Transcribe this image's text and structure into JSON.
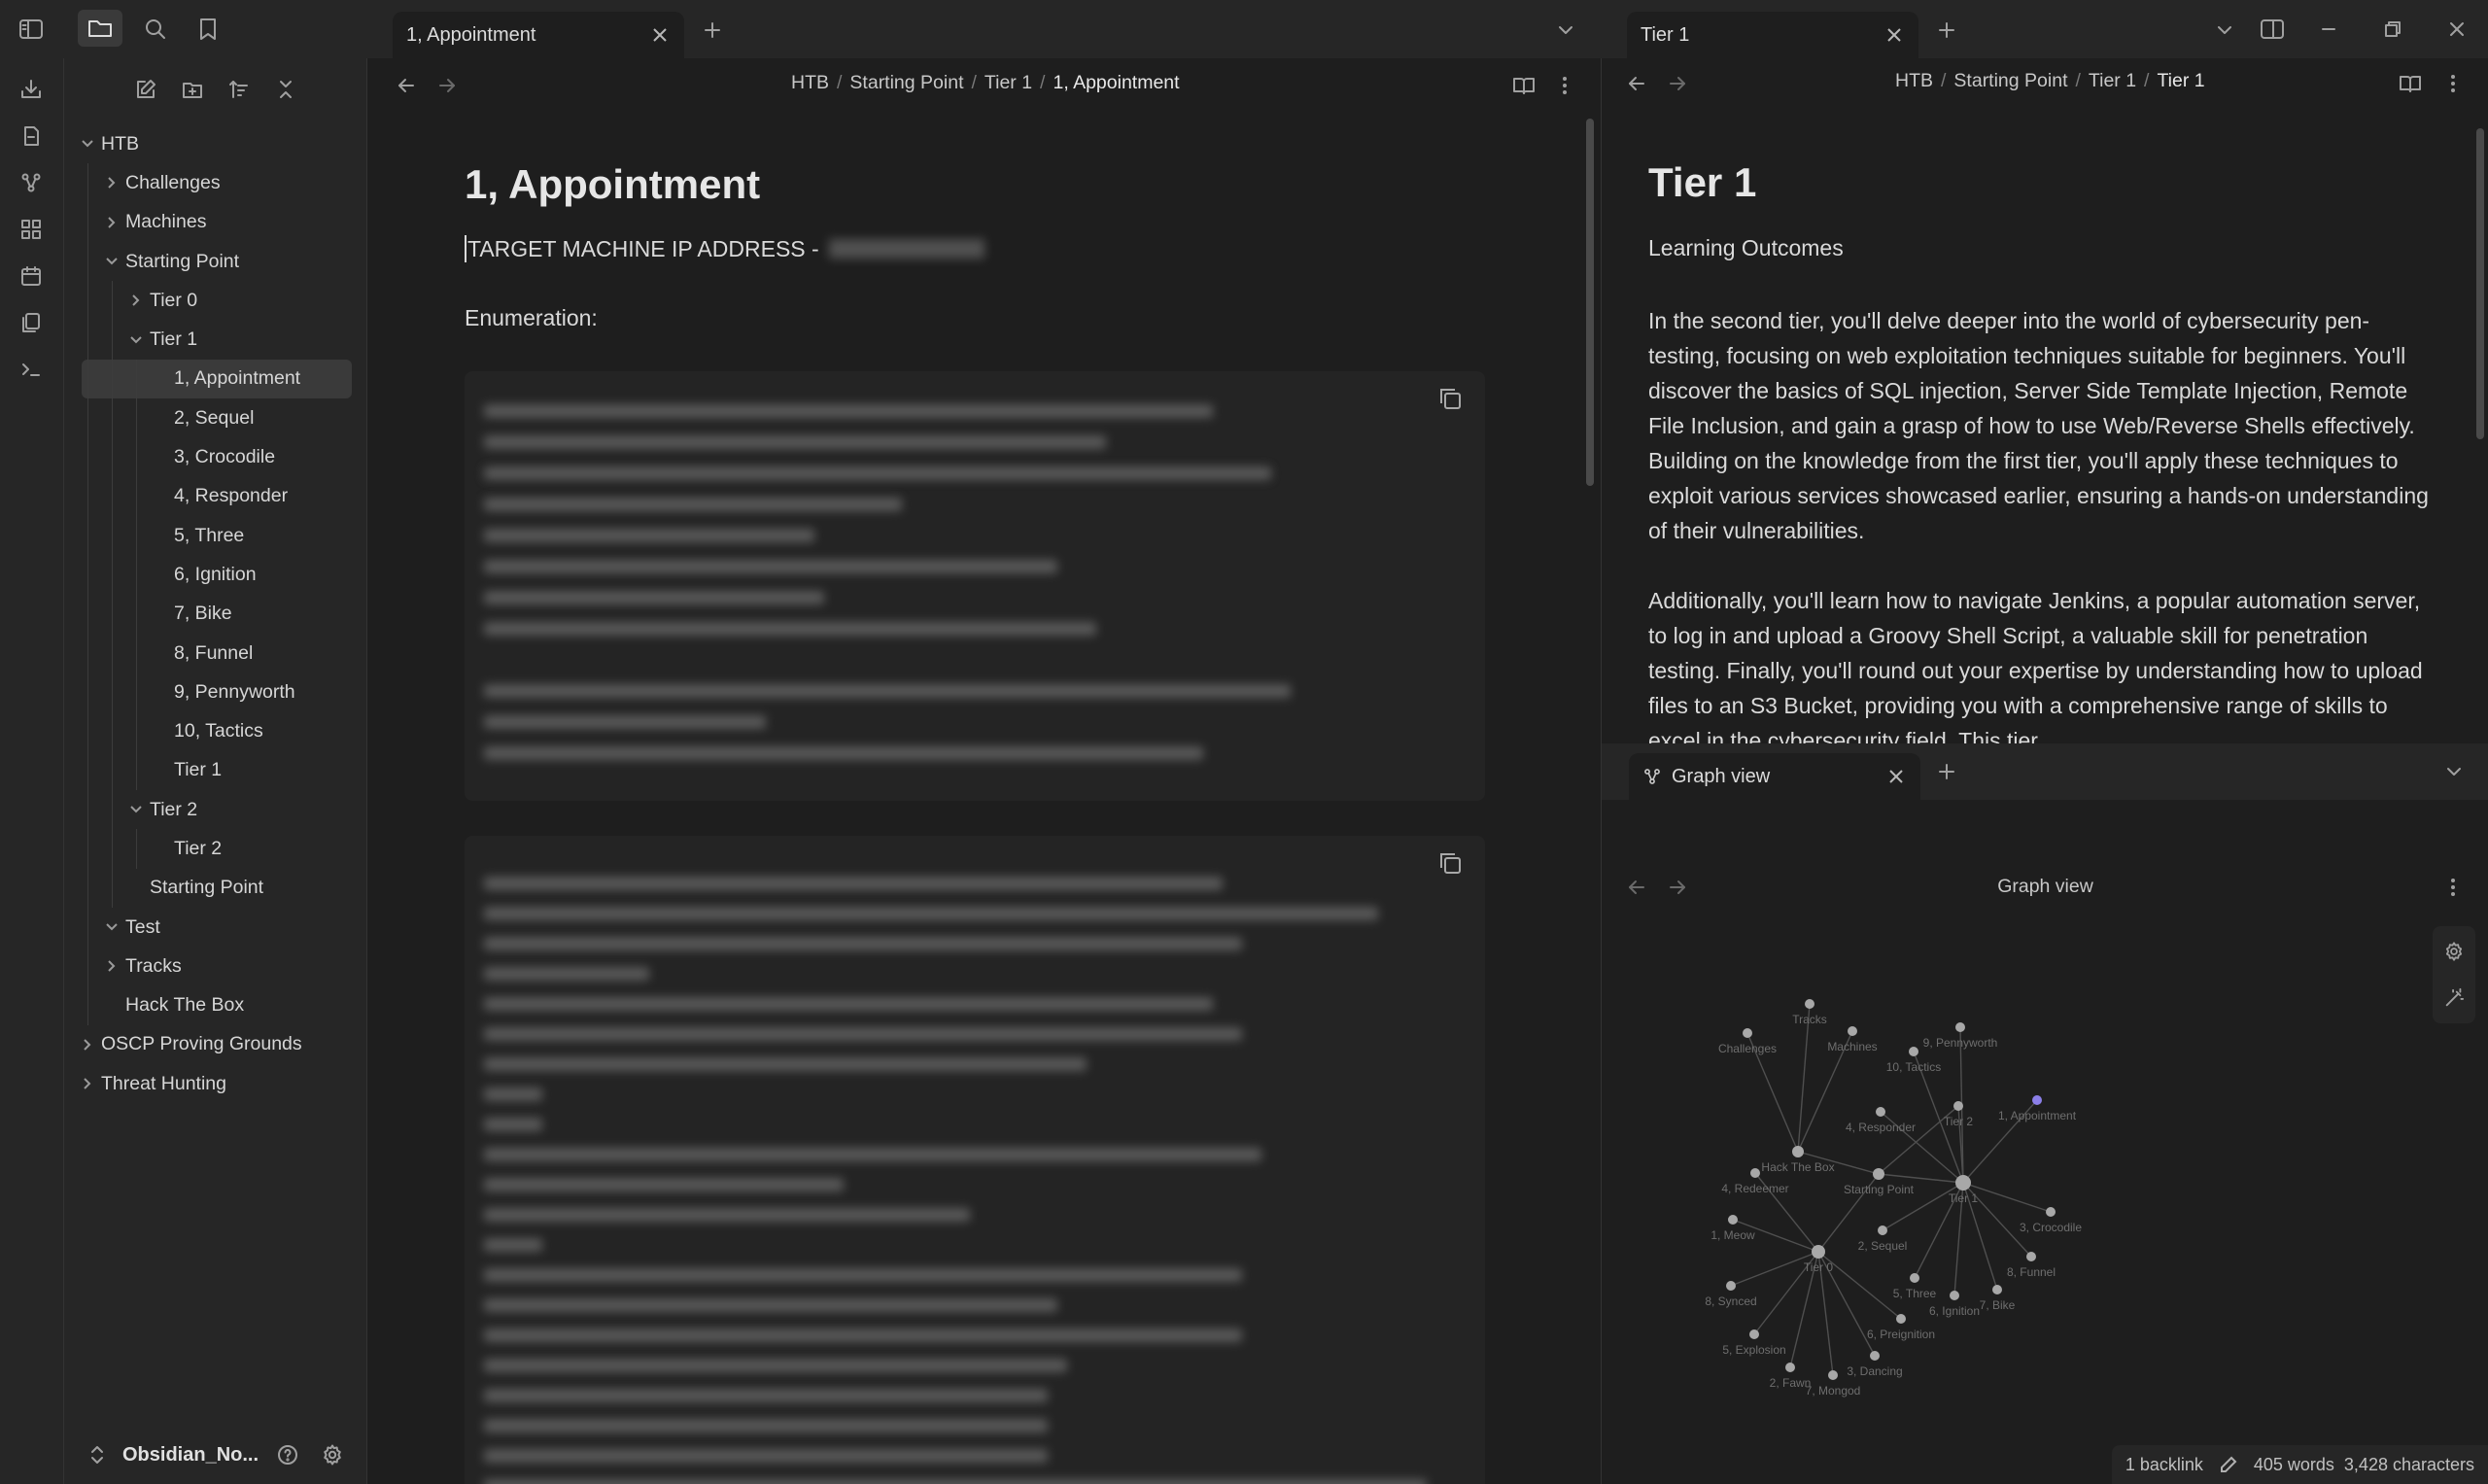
{
  "left_tab": {
    "label": "1, Appointment"
  },
  "right_tab": {
    "label": "Tier 1"
  },
  "graph_tab": {
    "label": "Graph view"
  },
  "vault": {
    "name": "Obsidian_No..."
  },
  "tree": [
    {
      "label": "HTB",
      "depth": 0,
      "chevron": "down"
    },
    {
      "label": "Challenges",
      "depth": 1,
      "chevron": "right"
    },
    {
      "label": "Machines",
      "depth": 1,
      "chevron": "right"
    },
    {
      "label": "Starting Point",
      "depth": 1,
      "chevron": "down"
    },
    {
      "label": "Tier 0",
      "depth": 2,
      "chevron": "right"
    },
    {
      "label": "Tier 1",
      "depth": 2,
      "chevron": "down"
    },
    {
      "label": "1, Appointment",
      "depth": 3,
      "chevron": "none",
      "active": true
    },
    {
      "label": "2, Sequel",
      "depth": 3,
      "chevron": "none"
    },
    {
      "label": "3, Crocodile",
      "depth": 3,
      "chevron": "none"
    },
    {
      "label": "4, Responder",
      "depth": 3,
      "chevron": "none"
    },
    {
      "label": "5, Three",
      "depth": 3,
      "chevron": "none"
    },
    {
      "label": "6, Ignition",
      "depth": 3,
      "chevron": "none"
    },
    {
      "label": "7, Bike",
      "depth": 3,
      "chevron": "none"
    },
    {
      "label": "8, Funnel",
      "depth": 3,
      "chevron": "none"
    },
    {
      "label": "9, Pennyworth",
      "depth": 3,
      "chevron": "none"
    },
    {
      "label": "10, Tactics",
      "depth": 3,
      "chevron": "none"
    },
    {
      "label": "Tier 1",
      "depth": 3,
      "chevron": "none"
    },
    {
      "label": "Tier 2",
      "depth": 2,
      "chevron": "down"
    },
    {
      "label": "Tier 2",
      "depth": 3,
      "chevron": "none"
    },
    {
      "label": "Starting Point",
      "depth": 2,
      "chevron": "none"
    },
    {
      "label": "Test",
      "depth": 1,
      "chevron": "down"
    },
    {
      "label": "Tracks",
      "depth": 1,
      "chevron": "right"
    },
    {
      "label": "Hack The Box",
      "depth": 1,
      "chevron": "none"
    },
    {
      "label": "OSCP Proving Grounds",
      "depth": 0,
      "chevron": "right"
    },
    {
      "label": "Threat Hunting",
      "depth": 0,
      "chevron": "right"
    }
  ],
  "left_note": {
    "breadcrumb": [
      "HTB",
      "Starting Point",
      "Tier 1",
      "1, Appointment"
    ],
    "title": "1, Appointment",
    "ip_line": "TARGET MACHINE IP ADDRESS -",
    "enumeration": "Enumeration:"
  },
  "right_note": {
    "breadcrumb": [
      "HTB",
      "Starting Point",
      "Tier 1",
      "Tier 1"
    ],
    "title": "Tier 1",
    "subtitle": "Learning Outcomes",
    "para1": "In the second tier, you'll delve deeper into the world of cybersecurity pen-testing, focusing on web exploitation techniques suitable for beginners. You'll discover the basics of SQL injection, Server Side Template Injection, Remote File Inclusion, and gain a grasp of how to use Web/Reverse Shells effectively. Building on the knowledge from the first tier, you'll apply these techniques to exploit various services showcased earlier, ensuring a hands-on understanding of their vulnerabilities.",
    "para2": "Additionally, you'll learn how to navigate Jenkins, a popular automation server, to log in and upload a Groovy Shell Script, a valuable skill for penetration testing. Finally, you'll round out your expertise by understanding how to upload files to an S3 Bucket, providing you with a comprehensive range of skills to excel in the cybersecurity field. This tier"
  },
  "graph": {
    "header": "Graph view",
    "node_color": "#a8a8a8",
    "accent_node_color": "#8b7fe8",
    "nodes": [
      {
        "id": "challenges",
        "label": "Challenges"
      },
      {
        "id": "tracks",
        "label": "Tracks"
      },
      {
        "id": "machines",
        "label": "Machines"
      },
      {
        "id": "tactics",
        "label": "10, Tactics"
      },
      {
        "id": "pennyworth",
        "label": "9, Pennyworth"
      },
      {
        "id": "appointment",
        "label": "1, Appointment",
        "accent": true
      },
      {
        "id": "responder",
        "label": "4, Responder"
      },
      {
        "id": "tier2",
        "label": "Tier 2"
      },
      {
        "id": "htb",
        "label": "Hack The Box"
      },
      {
        "id": "starting",
        "label": "Starting Point"
      },
      {
        "id": "tier1",
        "label": "Tier 1"
      },
      {
        "id": "redeemer",
        "label": "4, Redeemer"
      },
      {
        "id": "crocodile",
        "label": "3, Crocodile"
      },
      {
        "id": "meow",
        "label": "1, Meow"
      },
      {
        "id": "sequel",
        "label": "2, Sequel"
      },
      {
        "id": "tier0",
        "label": "Tier 0"
      },
      {
        "id": "funnel",
        "label": "8, Funnel"
      },
      {
        "id": "three",
        "label": "5, Three"
      },
      {
        "id": "synced",
        "label": "8, Synced"
      },
      {
        "id": "ignition",
        "label": "6, Ignition"
      },
      {
        "id": "bike",
        "label": "7, Bike"
      },
      {
        "id": "preignition",
        "label": "6, Preignition"
      },
      {
        "id": "explosion",
        "label": "5, Explosion"
      },
      {
        "id": "dancing",
        "label": "3, Dancing"
      },
      {
        "id": "fawn",
        "label": "2, Fawn"
      },
      {
        "id": "mongod",
        "label": "7, Mongod"
      }
    ],
    "edges": [
      [
        "challenges",
        "htb"
      ],
      [
        "tracks",
        "htb"
      ],
      [
        "machines",
        "htb"
      ],
      [
        "htb",
        "starting"
      ],
      [
        "starting",
        "tier1"
      ],
      [
        "starting",
        "tier0"
      ],
      [
        "starting",
        "tier2"
      ],
      [
        "tier1",
        "tactics"
      ],
      [
        "tier1",
        "pennyworth"
      ],
      [
        "tier1",
        "appointment"
      ],
      [
        "tier1",
        "responder"
      ],
      [
        "tier1",
        "tier2"
      ],
      [
        "tier1",
        "crocodile"
      ],
      [
        "tier1",
        "sequel"
      ],
      [
        "tier1",
        "funnel"
      ],
      [
        "tier1",
        "three"
      ],
      [
        "tier1",
        "ignition"
      ],
      [
        "tier1",
        "bike"
      ],
      [
        "tier0",
        "redeemer"
      ],
      [
        "tier0",
        "meow"
      ],
      [
        "tier0",
        "synced"
      ],
      [
        "tier0",
        "explosion"
      ],
      [
        "tier0",
        "fawn"
      ],
      [
        "tier0",
        "mongod"
      ],
      [
        "tier0",
        "dancing"
      ],
      [
        "tier0",
        "preignition"
      ]
    ]
  },
  "status": {
    "backlinks": "1 backlink",
    "words": "405 words",
    "characters": "3,428 characters"
  }
}
